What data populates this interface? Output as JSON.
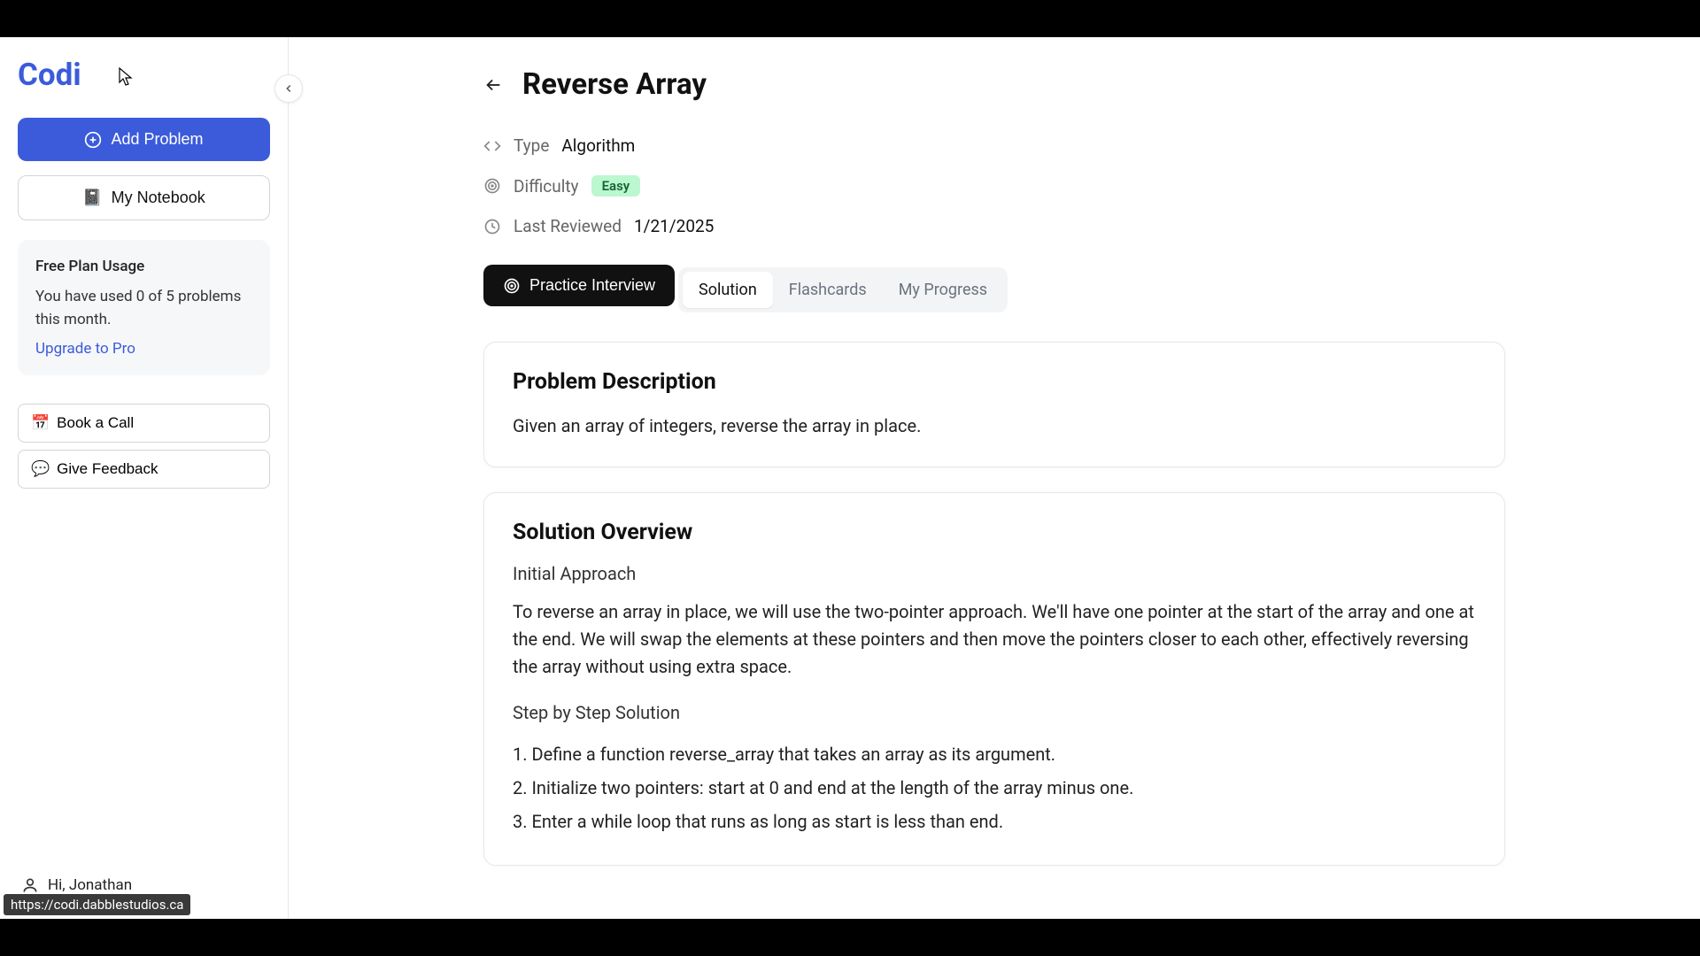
{
  "sidebar": {
    "logo": "Codi",
    "add_problem": "Add Problem",
    "notebook": "My Notebook",
    "plan": {
      "title": "Free Plan Usage",
      "text": "You have used 0 of 5 problems this month.",
      "upgrade": "Upgrade to Pro"
    },
    "book_call": "Book a Call",
    "feedback": "Give Feedback",
    "greeting": "Hi, Jonathan"
  },
  "status_url": "https://codi.dabblestudios.ca",
  "main": {
    "title": "Reverse Array",
    "meta": {
      "type_label": "Type",
      "type_value": "Algorithm",
      "difficulty_label": "Difficulty",
      "difficulty_value": "Easy",
      "reviewed_label": "Last Reviewed",
      "reviewed_value": "1/21/2025"
    },
    "practice": "Practice Interview",
    "tabs": {
      "solution": "Solution",
      "flashcards": "Flashcards",
      "progress": "My Progress"
    },
    "problem": {
      "heading": "Problem Description",
      "body": "Given an array of integers, reverse the array in place."
    },
    "solution": {
      "heading": "Solution Overview",
      "approach_label": "Initial Approach",
      "approach_body": "To reverse an array in place, we will use the two-pointer approach. We'll have one pointer at the start of the array and one at the end. We will swap the elements at these pointers and then move the pointers closer to each other, effectively reversing the array without using extra space.",
      "steps_label": "Step by Step Solution",
      "steps": [
        "1. Define a function reverse_array that takes an array as its argument.",
        "2. Initialize two pointers: start at 0 and end at the length of the array minus one.",
        "3. Enter a while loop that runs as long as start is less than end."
      ]
    }
  }
}
